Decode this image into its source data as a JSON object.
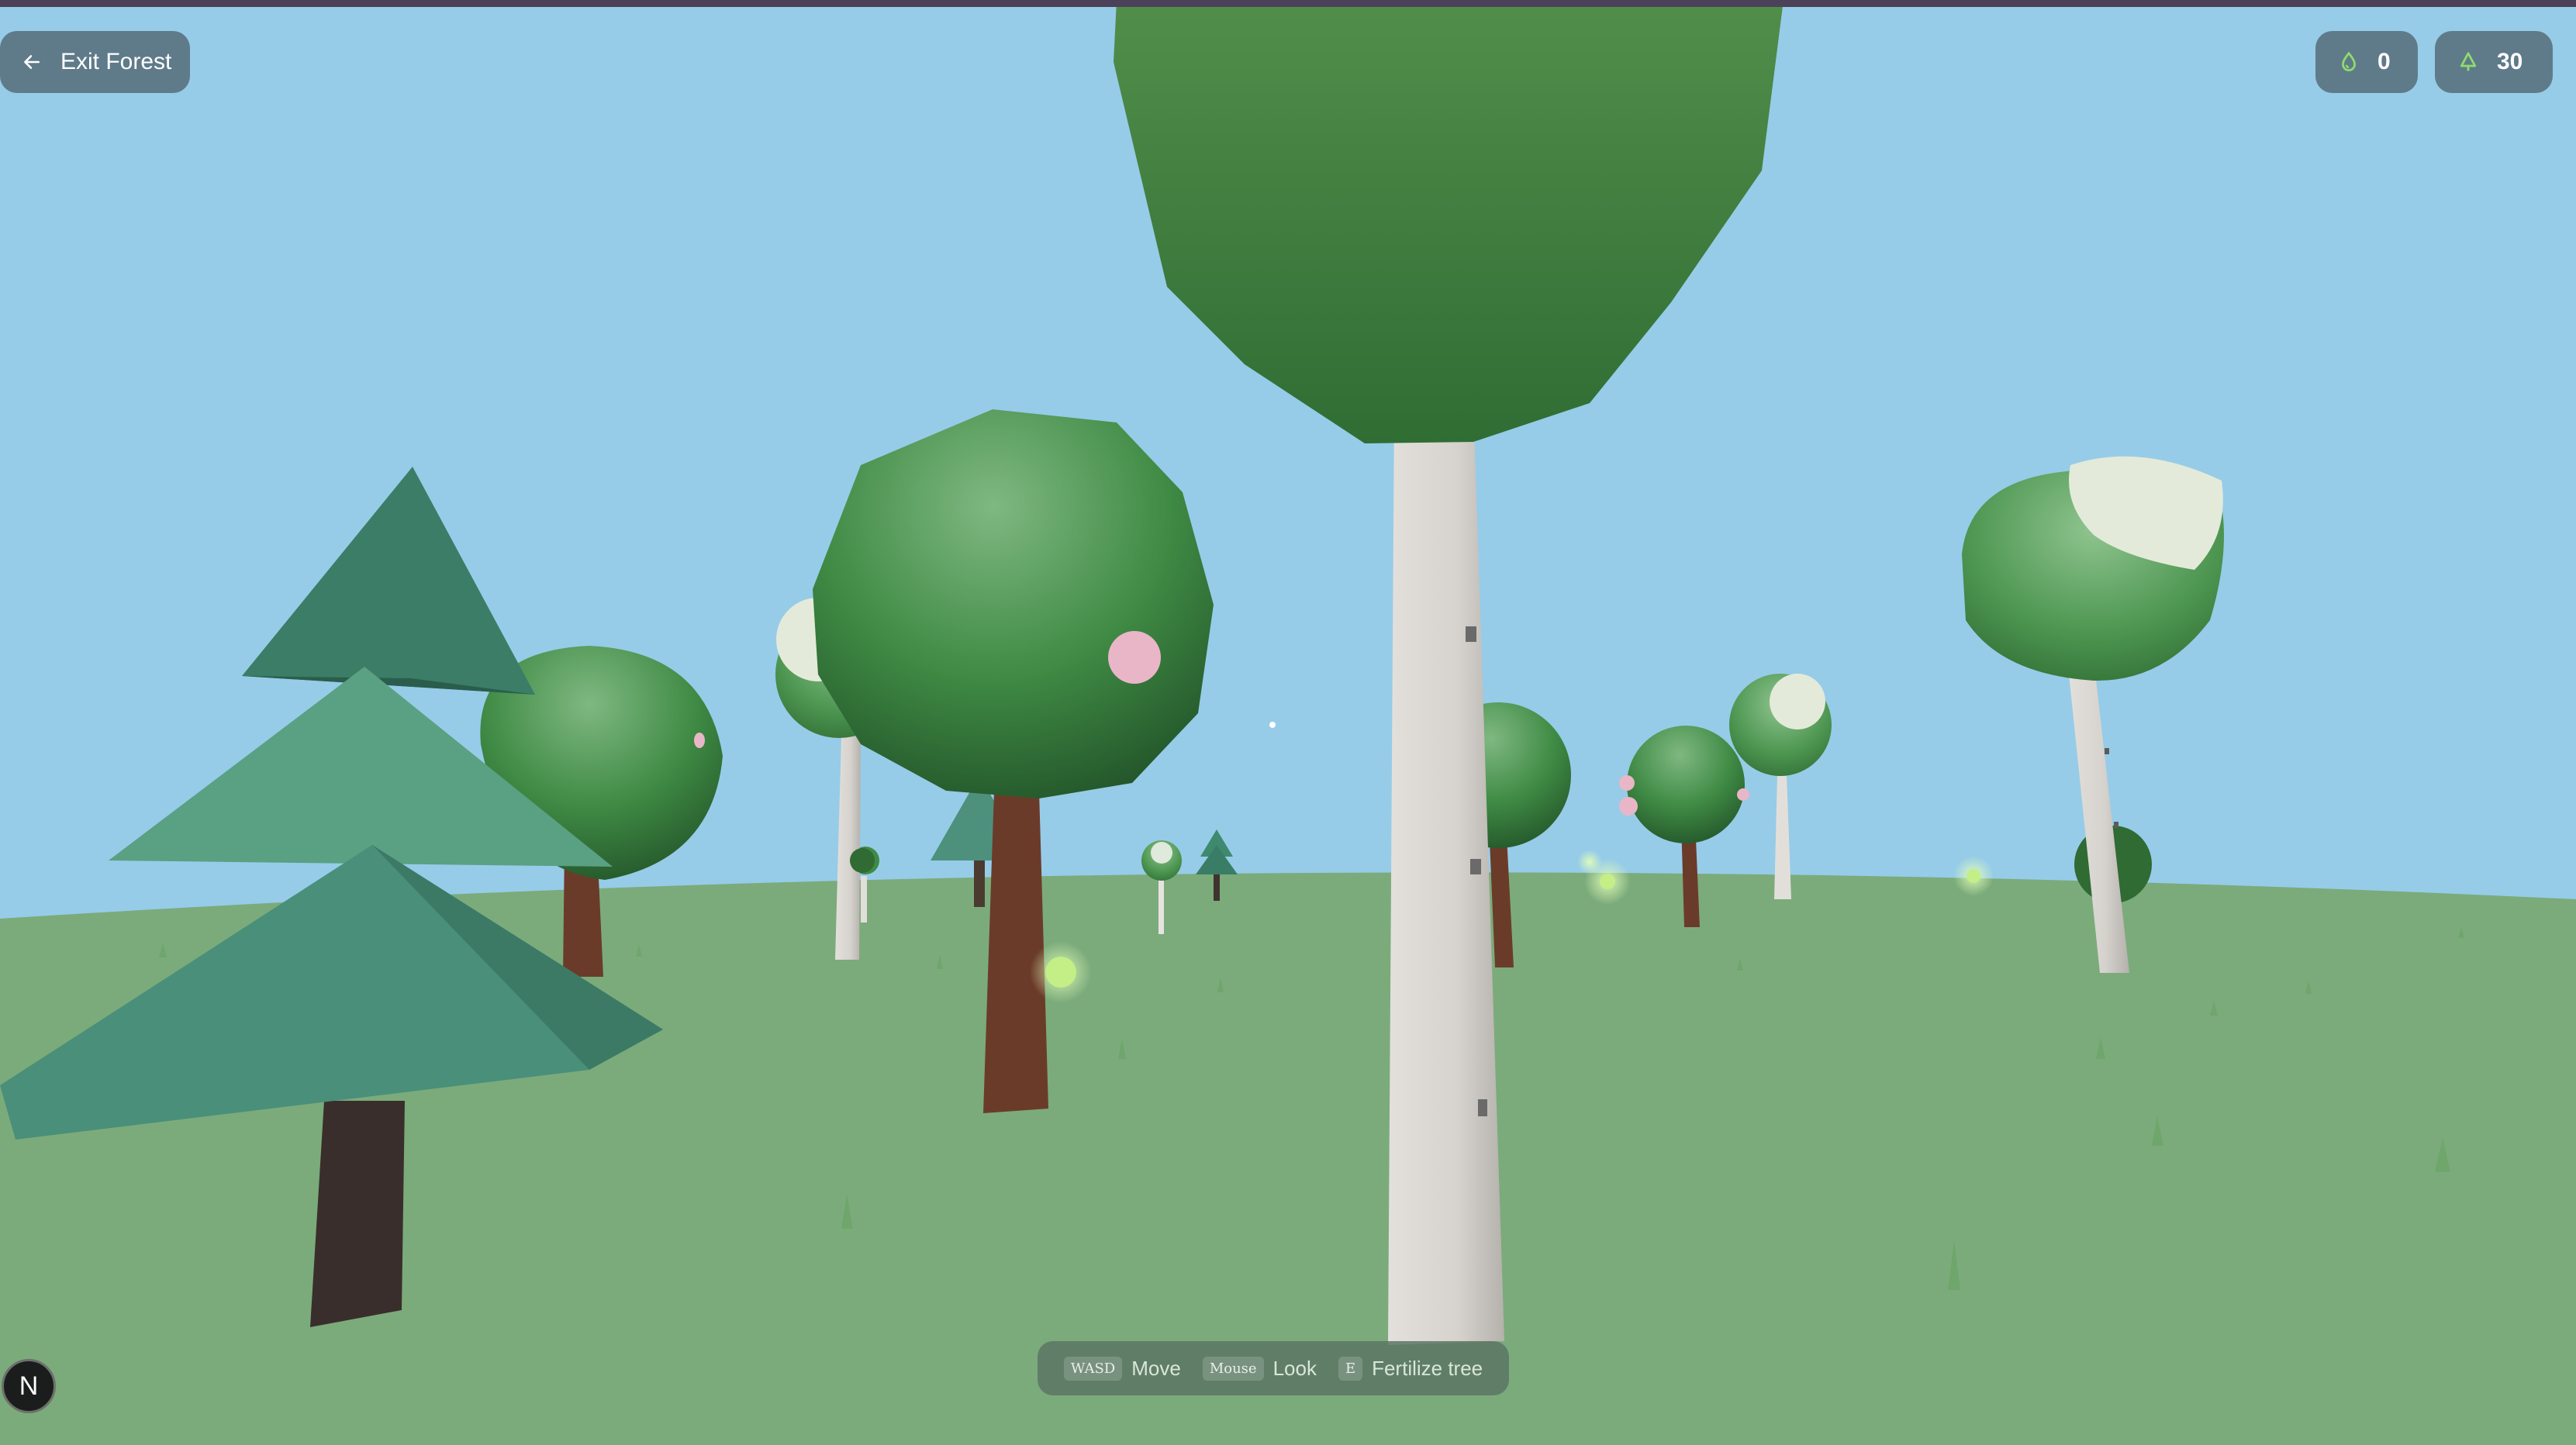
{
  "hud": {
    "exit_label": "Exit Forest",
    "exit_icon": "arrow-left-icon",
    "water_count": "0",
    "water_icon": "droplet-icon",
    "tree_count": "30",
    "tree_icon": "tree-icon"
  },
  "controls": {
    "move_key": "WASD",
    "move_label": "Move",
    "look_key": "Mouse",
    "look_label": "Look",
    "fertilize_key": "E",
    "fertilize_label": "Fertilize tree"
  },
  "badge": {
    "letter": "N"
  },
  "colors": {
    "sky": "#96cce8",
    "ground": "#7bab7b",
    "pine": "#4a8f7a",
    "oak_canopy": "#3f8a44",
    "birch_bark": "#d9d5d0",
    "trunk_brown": "#6b3b2a",
    "blossom": "#e9b6c8",
    "accent_green": "#8fdc6c"
  }
}
